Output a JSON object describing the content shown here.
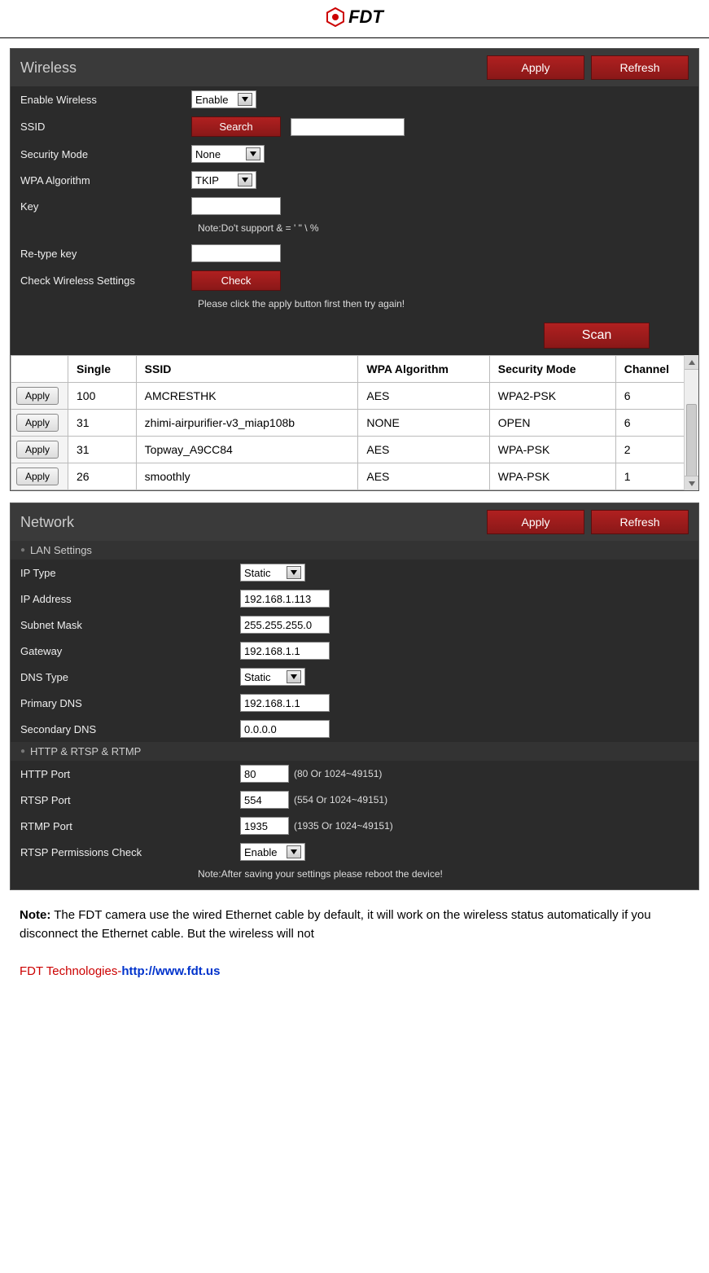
{
  "brand": "FDT",
  "wireless": {
    "title": "Wireless",
    "apply": "Apply",
    "refresh": "Refresh",
    "rows": {
      "enable_label": "Enable Wireless",
      "enable_value": "Enable",
      "ssid_label": "SSID",
      "ssid_search": "Search",
      "ssid_value": "",
      "security_label": "Security Mode",
      "security_value": "None",
      "wpa_label": "WPA Algorithm",
      "wpa_value": "TKIP",
      "key_label": "Key",
      "key_note": "Note:Do't support & = ' \" \\ %",
      "retype_label": "Re-type key",
      "check_label": "Check Wireless Settings",
      "check_btn": "Check",
      "check_hint": "Please click the apply button first then try again!"
    },
    "scan_btn": "Scan",
    "table": {
      "headers": [
        "",
        "Single",
        "SSID",
        "WPA Algorithm",
        "Security Mode",
        "Channel"
      ],
      "apply_label": "Apply",
      "rows": [
        {
          "single": "100",
          "ssid": "AMCRESTHK",
          "wpa": "AES",
          "sec": "WPA2-PSK",
          "ch": "6"
        },
        {
          "single": "31",
          "ssid": "zhimi-airpurifier-v3_miap108b",
          "wpa": "NONE",
          "sec": "OPEN",
          "ch": "6"
        },
        {
          "single": "31",
          "ssid": "Topway_A9CC84",
          "wpa": "AES",
          "sec": "WPA-PSK",
          "ch": "2"
        },
        {
          "single": "26",
          "ssid": "smoothly",
          "wpa": "AES",
          "sec": "WPA-PSK",
          "ch": "1"
        }
      ]
    }
  },
  "network": {
    "title": "Network",
    "apply": "Apply",
    "refresh": "Refresh",
    "lan_section": "LAN Settings",
    "rows": {
      "iptype_label": "IP Type",
      "iptype_value": "Static",
      "ip_label": "IP Address",
      "ip_value": "192.168.1.113",
      "subnet_label": "Subnet Mask",
      "subnet_value": "255.255.255.0",
      "gateway_label": "Gateway",
      "gateway_value": "192.168.1.1",
      "dnstype_label": "DNS Type",
      "dnstype_value": "Static",
      "pdns_label": "Primary DNS",
      "pdns_value": "192.168.1.1",
      "sdns_label": "Secondary DNS",
      "sdns_value": "0.0.0.0"
    },
    "http_section": "HTTP & RTSP & RTMP",
    "ports": {
      "http_label": "HTTP Port",
      "http_value": "80",
      "http_hint": "(80 Or 1024~49151)",
      "rtsp_label": "RTSP Port",
      "rtsp_value": "554",
      "rtsp_hint": "(554 Or 1024~49151)",
      "rtmp_label": "RTMP Port",
      "rtmp_value": "1935",
      "rtmp_hint": "(1935 Or 1024~49151)",
      "perm_label": "RTSP Permissions Check",
      "perm_value": "Enable",
      "save_note": "Note:After saving your settings please reboot the device!"
    }
  },
  "note": {
    "prefix": "Note:",
    "text": " The FDT camera use the wired Ethernet cable by default, it will work on the wireless status automatically if you disconnect the Ethernet cable. But the wireless will not"
  },
  "footer": {
    "company": "FDT Technologies-",
    "url": "http://www.fdt.us"
  }
}
